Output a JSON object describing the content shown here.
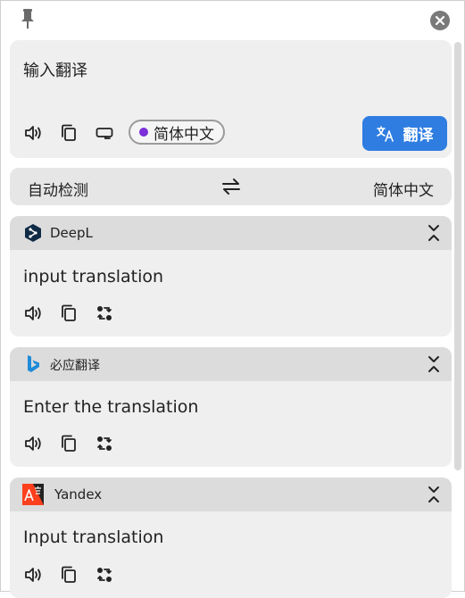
{
  "input": {
    "text": "输入翻译",
    "lang_chip": "简体中文",
    "translate_label": "翻译"
  },
  "lang_bar": {
    "source": "自动检测",
    "target": "简体中文"
  },
  "results": [
    {
      "service": "DeepL",
      "text": "input translation"
    },
    {
      "service": "必应翻译",
      "text": "Enter the translation"
    },
    {
      "service": "Yandex",
      "text": "Input translation"
    }
  ],
  "colors": {
    "accent": "#2f7de1",
    "chip_dot": "#7b30d9",
    "deepl": "#0f2b46",
    "bing": "#1f8bd8",
    "yandex": "#fc3f1d"
  },
  "icons": [
    "pin-icon",
    "close-icon",
    "speaker-icon",
    "copy-icon",
    "keyboard-icon",
    "translate-icon",
    "swap-icon",
    "collapse-icon",
    "convert-icon"
  ]
}
